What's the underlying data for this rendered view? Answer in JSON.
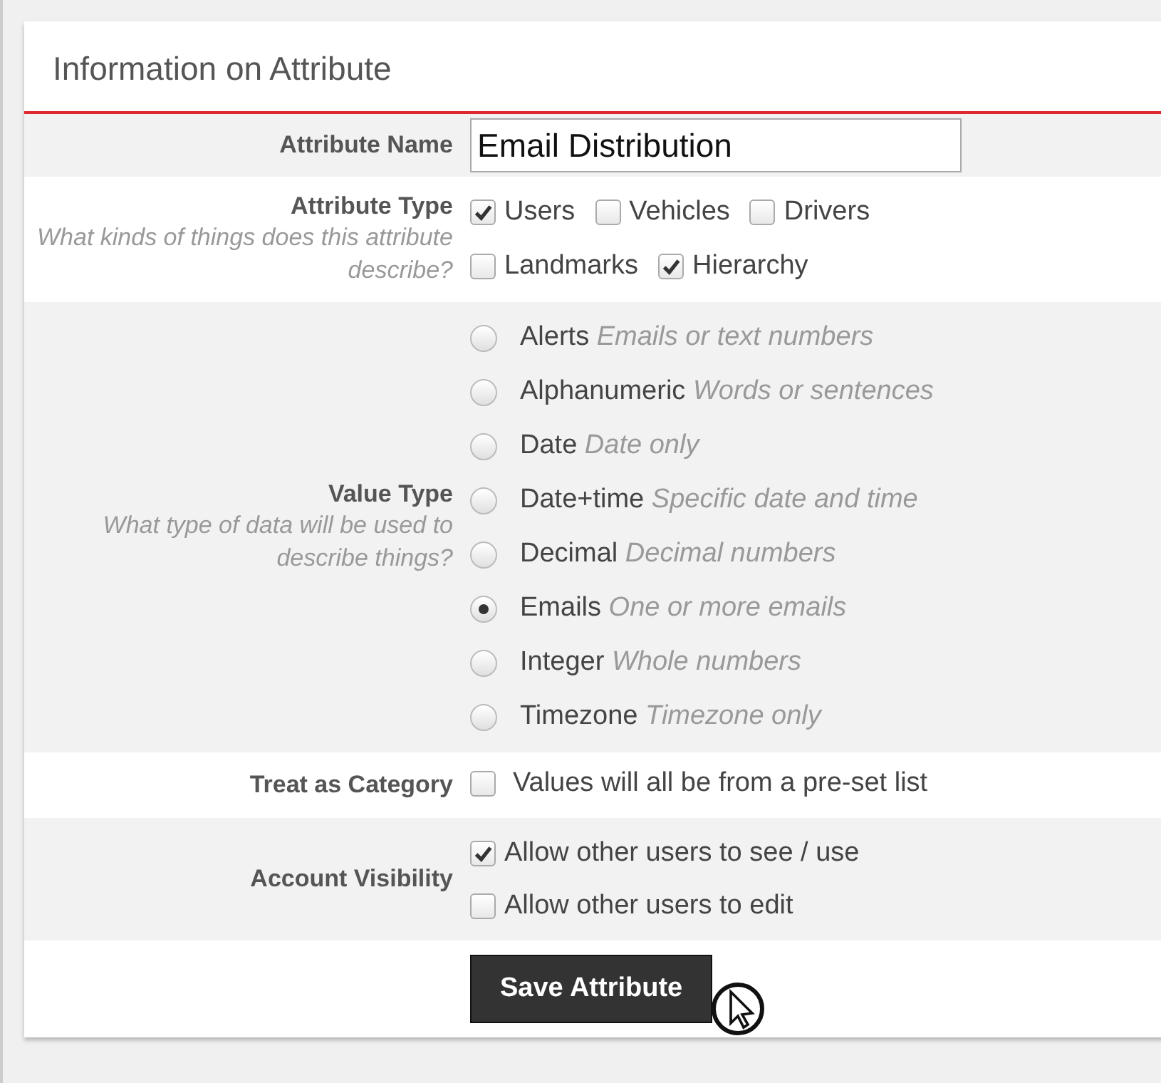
{
  "panel": {
    "title": "Information on Attribute"
  },
  "attribute_name": {
    "label": "Attribute Name",
    "value": "Email Distribution"
  },
  "attribute_type": {
    "label": "Attribute Type",
    "hint": "What kinds of things does this attribute describe?",
    "options": [
      {
        "label": "Users",
        "checked": true
      },
      {
        "label": "Vehicles",
        "checked": false
      },
      {
        "label": "Drivers",
        "checked": false
      },
      {
        "label": "Landmarks",
        "checked": false
      },
      {
        "label": "Hierarchy",
        "checked": true
      }
    ]
  },
  "value_type": {
    "label": "Value Type",
    "hint": "What type of data will be used to describe things?",
    "options": [
      {
        "label": "Alerts",
        "description": "Emails or text numbers",
        "selected": false
      },
      {
        "label": "Alphanumeric",
        "description": "Words or sentences",
        "selected": false
      },
      {
        "label": "Date",
        "description": "Date only",
        "selected": false
      },
      {
        "label": "Date+time",
        "description": "Specific date and time",
        "selected": false
      },
      {
        "label": "Decimal",
        "description": "Decimal numbers",
        "selected": false
      },
      {
        "label": "Emails",
        "description": "One or more emails",
        "selected": true
      },
      {
        "label": "Integer",
        "description": "Whole numbers",
        "selected": false
      },
      {
        "label": "Timezone",
        "description": "Timezone only",
        "selected": false
      }
    ]
  },
  "treat_as_category": {
    "label": "Treat as Category",
    "options": [
      {
        "label": "Values will all be from a pre-set list",
        "checked": false
      }
    ]
  },
  "account_visibility": {
    "label": "Account Visibility",
    "options": [
      {
        "label": "Allow other users to see / use",
        "checked": true
      },
      {
        "label": "Allow other users to edit",
        "checked": false
      }
    ]
  },
  "save_button": {
    "label": "Save Attribute"
  }
}
